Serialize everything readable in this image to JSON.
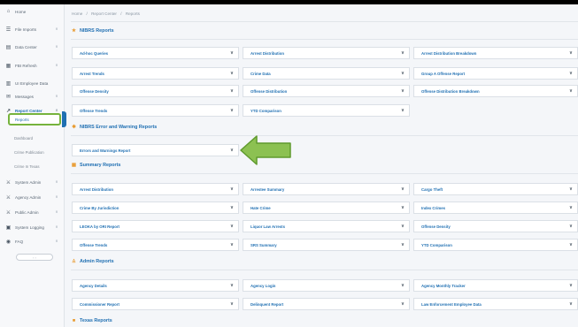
{
  "sidebar": {
    "items": [
      {
        "label": "Home",
        "icon": "home-icon",
        "glyph": "⌂",
        "chevron": ""
      },
      {
        "label": "File Imports",
        "icon": "file-icon",
        "glyph": "☰",
        "chevron": "∨"
      },
      {
        "label": "Data Center",
        "icon": "database-icon",
        "glyph": "▤",
        "chevron": "∨"
      },
      {
        "label": "FBI Refresh",
        "icon": "refresh-icon",
        "glyph": "▦",
        "chevron": "∨"
      },
      {
        "label": "UI Employee Data",
        "icon": "employee-icon",
        "glyph": "▥",
        "chevron": ""
      },
      {
        "label": "Messages",
        "icon": "envelope-icon",
        "glyph": "✉",
        "chevron": "∨"
      },
      {
        "label": "Report Center",
        "icon": "chart-icon",
        "glyph": "↗",
        "chevron": "∧"
      }
    ],
    "subitems": [
      "Reports",
      "Dashboard",
      "Crime Publication",
      "Crime In Texas"
    ],
    "items2": [
      {
        "label": "System Admin",
        "icon": "users-icon",
        "glyph": "⚔",
        "chevron": "∨"
      },
      {
        "label": "Agency Admin",
        "icon": "users-icon",
        "glyph": "⚔",
        "chevron": "∨"
      },
      {
        "label": "Public Admin",
        "icon": "users-icon",
        "glyph": "⚔",
        "chevron": "∨"
      },
      {
        "label": "System Logging",
        "icon": "log-icon",
        "glyph": "▣",
        "chevron": "∨"
      },
      {
        "label": "FAQ",
        "icon": "help-icon",
        "glyph": "◉",
        "chevron": "∨"
      }
    ],
    "scroll_glyph": "‹ ›"
  },
  "breadcrumb": [
    "Home",
    "/",
    "Report Center",
    "/",
    "Reports"
  ],
  "sections": [
    {
      "title": "NIBRS Reports",
      "icon": "★"
    },
    {
      "title": "NIBRS Error and Warning Reports",
      "icon": "✱"
    },
    {
      "title": "Summary Reports",
      "icon": "▦"
    },
    {
      "title": "Admin Reports",
      "icon": "♙"
    },
    {
      "title": "Texas Reports",
      "icon": "■"
    }
  ],
  "nibrs": [
    [
      "Ad-hoc Queries",
      "Arrest Distribution",
      "Arrest Distribution Breakdown"
    ],
    [
      "Arrest Trends",
      "Crime Data",
      "Group A Offense Report"
    ],
    [
      "Offense Density",
      "Offense Distribution",
      "Offense Distribution Breakdown"
    ],
    [
      "Offense Trends",
      "YTD Comparison",
      ""
    ]
  ],
  "errors": [
    [
      "Errors and Warnings Report"
    ]
  ],
  "summary": [
    [
      "Arrest Distribution",
      "Arrestee Summary",
      "Cargo Theft"
    ],
    [
      "Crime By Jurisdiction",
      "Hate Crime",
      "Index Crimes"
    ],
    [
      "LEOKA by ORI Report",
      "Liquor Law Arrests",
      "Offense Density"
    ],
    [
      "Offense Trends",
      "SRS Summary",
      "YTD Comparison"
    ]
  ],
  "admin": [
    [
      "Agency Details",
      "Agency Login",
      "Agency Monthly Tracker"
    ],
    [
      "Commissioner Report",
      "Delinquent Report",
      "Law Enforcement Employee Data"
    ]
  ],
  "caret": "∨",
  "colors": {
    "accent": "#1f6fb2",
    "highlight": "#76b33c",
    "arrow": "#8cc152"
  }
}
